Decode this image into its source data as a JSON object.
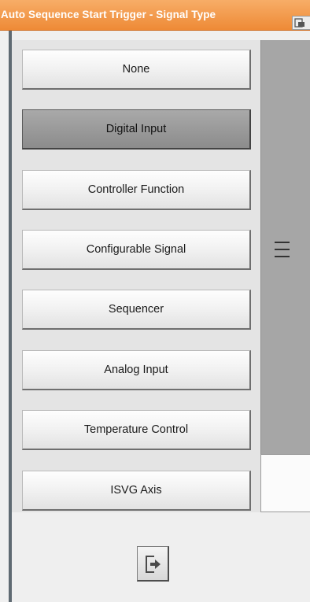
{
  "window": {
    "title": "Auto Sequence Start Trigger - Signal Type"
  },
  "options": [
    {
      "label": "None",
      "selected": false
    },
    {
      "label": "Digital Input",
      "selected": true
    },
    {
      "label": "Controller Function",
      "selected": false
    },
    {
      "label": "Configurable Signal",
      "selected": false
    },
    {
      "label": "Sequencer",
      "selected": false
    },
    {
      "label": "Analog Input",
      "selected": false
    },
    {
      "label": "Temperature Control",
      "selected": false
    },
    {
      "label": "ISVG Axis",
      "selected": false
    }
  ],
  "icons": {
    "title_icon": "window-restore-icon",
    "drag_handle": "drag-handle-icon",
    "exit": "exit-door-icon"
  },
  "colors": {
    "title_bar": "#ef9040",
    "selected_option": "#8f8f8f",
    "scroll_column": "#a6a6a6"
  }
}
